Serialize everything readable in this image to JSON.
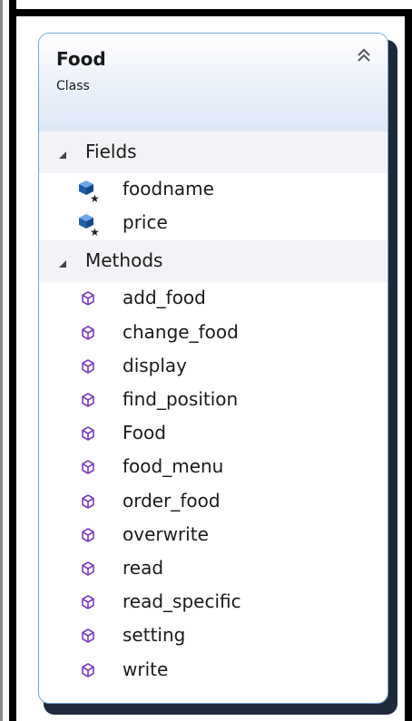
{
  "class_box": {
    "name": "Food",
    "kind": "Class",
    "collapse_icon": "double-chevron-up-icon",
    "sections": [
      {
        "id": "fields",
        "label": "Fields",
        "expanded": true,
        "item_icon": "field-icon",
        "items": [
          "foodname",
          "price"
        ]
      },
      {
        "id": "methods",
        "label": "Methods",
        "expanded": true,
        "item_icon": "method-icon",
        "items": [
          "add_food",
          "change_food",
          "display",
          "find_position",
          "Food",
          "food_menu",
          "order_food",
          "overwrite",
          "read",
          "read_specific",
          "setting",
          "write"
        ]
      }
    ]
  },
  "colors": {
    "border": "#76a7d6",
    "header_gradient_end": "#dde7f4",
    "section_background": "#f1f3f6",
    "field_icon": "#1d5fa8",
    "method_icon": "#7b3fb8",
    "shadow": "#1e2a3a"
  }
}
